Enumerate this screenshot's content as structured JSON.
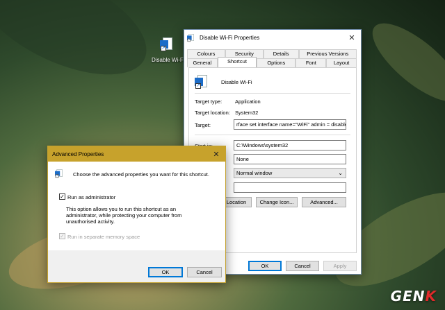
{
  "desktop": {
    "icon_label": "Disable Wi-Fi"
  },
  "props_window": {
    "title": "Disable Wi-Fi Properties",
    "tabs_row1": [
      "Colours",
      "Security",
      "Details",
      "Previous Versions"
    ],
    "tabs_row2": [
      "General",
      "Shortcut",
      "Options",
      "Font",
      "Layout"
    ],
    "active_tab": "Shortcut",
    "shortcut_name": "Disable Wi-Fi",
    "target_type_label": "Target type:",
    "target_type_value": "Application",
    "target_location_label": "Target location:",
    "target_location_value": "System32",
    "target_label": "Target:",
    "target_value": "rface set interface name=\"WiFi\" admin = disabled",
    "start_in_label": "Start in:",
    "start_in_value": "C:\\Windows\\system32",
    "shortcut_key_value": "None",
    "run_value": "Normal window",
    "comment_value": "",
    "open_location_button": "Location",
    "change_icon_button": "Change Icon...",
    "advanced_button": "Advanced...",
    "ok_button": "OK",
    "cancel_button": "Cancel",
    "apply_button": "Apply"
  },
  "advanced_window": {
    "title": "Advanced Properties",
    "description": "Choose the advanced properties you want for this shortcut.",
    "run_as_admin_label": "Run as administrator",
    "run_as_admin_checked": true,
    "run_as_admin_help": "This option allows you to run this shortcut as an administrator, while protecting your computer from unauthorised activity.",
    "separate_memory_label": "Run in separate memory space",
    "separate_memory_checked": true,
    "separate_memory_enabled": false,
    "ok_button": "OK",
    "cancel_button": "Cancel"
  },
  "watermark": {
    "text_main": "GEN",
    "text_accent": "K"
  },
  "colors": {
    "accent_blue": "#0078d7",
    "advanced_titlebar": "#c7a22c",
    "watermark_accent": "#e02a2a"
  },
  "icons": [
    "shortcut-app-icon",
    "close-icon",
    "chevron-down-icon",
    "checkbox-check-icon",
    "shield-icon"
  ]
}
